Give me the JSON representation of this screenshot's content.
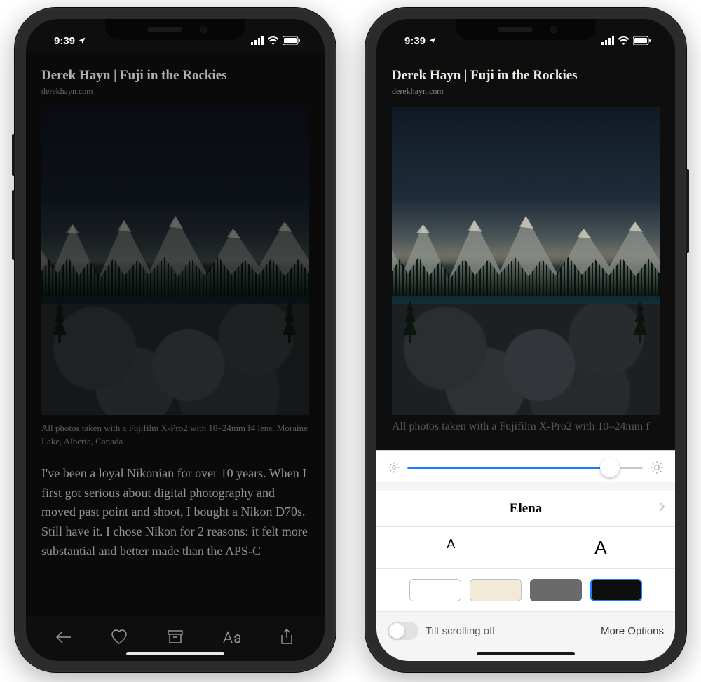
{
  "status": {
    "time": "9:39"
  },
  "article": {
    "title": "Derek Hayn | Fuji in the Rockies",
    "source": "derekhayn.com",
    "caption": "All photos taken with a Fujifilm X-Pro2 with 10–24mm f4 lens. Moraine Lake, Alberta, Canada",
    "caption_clipped": "All photos taken with a Fujifilm X-Pro2 with 10–24mm f",
    "body": "I've been a loyal Nikonian for over 10 years. When I first got serious about digital photography and moved past point and shoot, I bought a Nikon D70s. Still have it. I chose Nikon for 2 reasons: it felt more substantial and better made than the APS-C"
  },
  "settings": {
    "font_name": "Elena",
    "size_small": "A",
    "size_large": "A",
    "tilt_label": "Tilt scrolling off",
    "more_label": "More Options",
    "brightness_percent": 86,
    "themes": [
      "white",
      "sepia",
      "gray",
      "black"
    ],
    "selected_theme": "black"
  }
}
